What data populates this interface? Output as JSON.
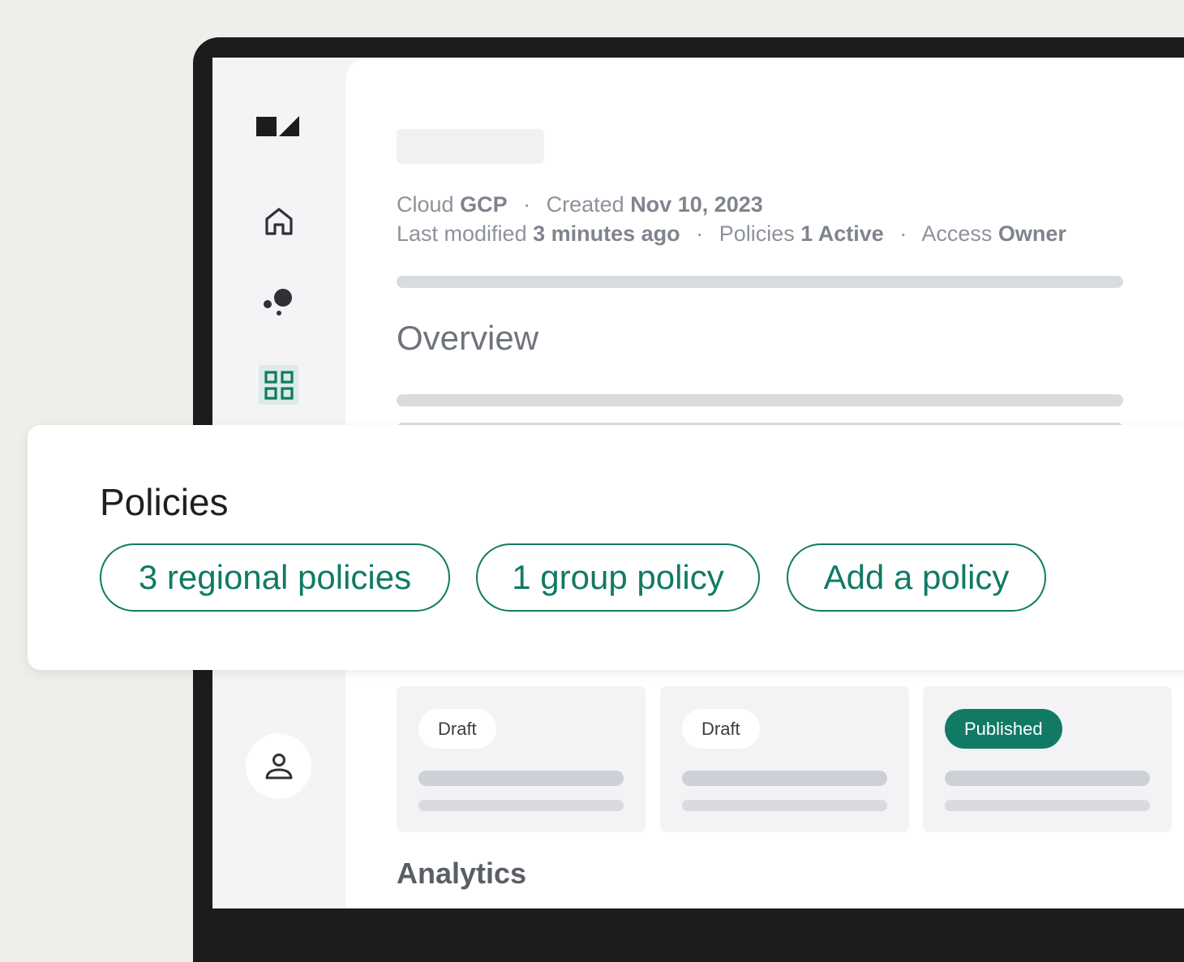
{
  "meta": {
    "cloud_label": "Cloud",
    "cloud_value": "GCP",
    "created_label": "Created",
    "created_value": "Nov 10, 2023",
    "modified_label": "Last modified",
    "modified_value": "3 minutes ago",
    "policies_label": "Policies",
    "policies_value": "1 Active",
    "access_label": "Access",
    "access_value": "Owner",
    "separator": "·"
  },
  "sections": {
    "overview": "Overview",
    "analytics": "Analytics"
  },
  "policies": {
    "title": "Policies",
    "buttons": [
      "3 regional policies",
      "1 group policy",
      "Add a policy"
    ]
  },
  "status_cards": [
    {
      "status": "Draft",
      "color": "#ffffff"
    },
    {
      "status": "Draft",
      "color": "#ffffff"
    },
    {
      "status": "Published",
      "color": "#117a65"
    }
  ],
  "icons": [
    "logo-icon",
    "home-icon",
    "nodes-icon",
    "grid-icon",
    "user-icon"
  ],
  "colors": {
    "accent": "#117a65",
    "active_nav_bg": "#dcebe6"
  }
}
